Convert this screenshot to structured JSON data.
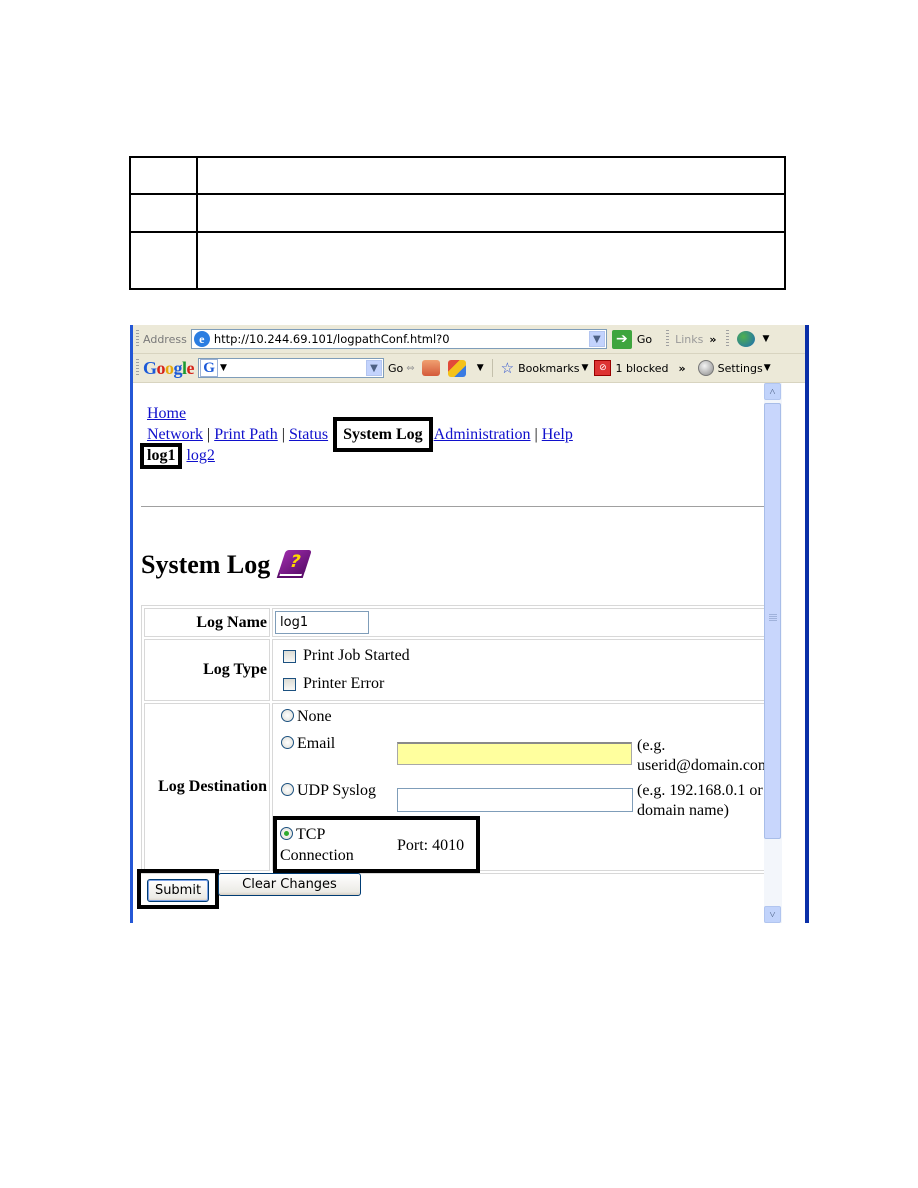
{
  "document_table": {
    "rows": [
      {
        "cells": [
          "",
          ""
        ]
      },
      {
        "cells": [
          "",
          ""
        ]
      },
      {
        "cells": [
          "",
          ""
        ]
      }
    ]
  },
  "browser": {
    "address_bar": {
      "label": "Address",
      "url": "http://10.244.69.101/logpathConf.html?0",
      "go_label": "Go",
      "links_label": "Links",
      "chevron": "»"
    },
    "google_toolbar": {
      "logo": "Google",
      "search_value": "",
      "go_label": "Go",
      "bookmarks_label": "Bookmarks",
      "blocked_label": "1 blocked",
      "chevron": "»",
      "settings_label": "Settings"
    }
  },
  "page": {
    "nav": {
      "home": "Home",
      "items": [
        {
          "label": "Network",
          "current": false
        },
        {
          "label": "Print Path",
          "current": false
        },
        {
          "label": "Status",
          "current": false
        },
        {
          "label": "System Log",
          "current": true
        },
        {
          "label": "Administration",
          "current": false
        },
        {
          "label": "Help",
          "current": false
        }
      ],
      "separator": "|",
      "sub_items": [
        {
          "label": "log1",
          "current": true
        },
        {
          "label": "log2",
          "current": false
        }
      ]
    },
    "title": "System Log",
    "form": {
      "log_name": {
        "label": "Log Name",
        "value": "log1"
      },
      "log_type": {
        "label": "Log Type",
        "options": [
          {
            "label": "Print Job Started",
            "checked": false
          },
          {
            "label": "Printer Error",
            "checked": false
          }
        ]
      },
      "log_destination": {
        "label": "Log Destination",
        "options": {
          "none": {
            "label": "None",
            "selected": false
          },
          "email": {
            "label": "Email",
            "selected": false,
            "value": "",
            "hint_line1": "(e.g.",
            "hint_line2": "userid@domain.com)"
          },
          "udp": {
            "label": "UDP Syslog",
            "selected": false,
            "value": "",
            "hint_line1": "(e.g. 192.168.0.1 or",
            "hint_line2": "domain name)"
          },
          "tcp": {
            "label_line1": "TCP",
            "label_line2": "Connection",
            "selected": true,
            "port_text": "Port: 4010"
          }
        }
      }
    },
    "buttons": {
      "submit": "Submit",
      "clear": "Clear Changes"
    }
  },
  "colors": {
    "link": "#1010cc",
    "email_field_bg": "#ffff9e",
    "window_frame": "#2457d6",
    "toolbar_bg": "#ece9d8"
  }
}
